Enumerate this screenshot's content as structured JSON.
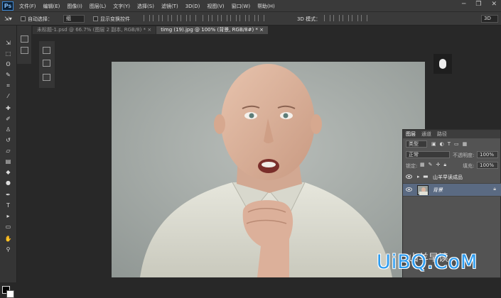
{
  "app": {
    "logo": "Ps"
  },
  "menu": [
    "文件(F)",
    "编辑(E)",
    "图像(I)",
    "图层(L)",
    "文字(Y)",
    "选择(S)",
    "滤镜(T)",
    "3D(D)",
    "视图(V)",
    "窗口(W)",
    "帮助(H)"
  ],
  "window_controls": {
    "minimize": "─",
    "restore": "❐",
    "close": "✕"
  },
  "options": {
    "auto_select_label": "自动选择：",
    "auto_select_value": "组",
    "transform_label": "显示变换控件",
    "mode_3d_label": "3D 模式：",
    "workspace": "3D"
  },
  "tabs": [
    {
      "label": "未标题-1.psd @ 66.7% (图层 2 副本, RGB/8) *",
      "active": false
    },
    {
      "label": "timg (19).jpg @ 100% (背景, RGB/8#) *",
      "active": true
    }
  ],
  "layers_panel": {
    "tabs": [
      "图层",
      "通道",
      "路径"
    ],
    "active_tab": "图层",
    "filter": "类型",
    "blend_mode": "正常",
    "opacity_label": "不透明度:",
    "opacity": "100%",
    "lock_label": "锁定:",
    "fill_label": "填充:",
    "fill": "100%",
    "layers": [
      {
        "name": "山羊早读成品",
        "type": "group"
      },
      {
        "name": "背景",
        "type": "image",
        "selected": true
      }
    ]
  },
  "watermark": {
    "text": "UiBQ.CoM",
    "overlay": "山羊早读"
  },
  "colors": {
    "selected_layer": "#5a6a82",
    "canvas_bg": "#a9b0ad",
    "ps_blue": "#3a87d6"
  }
}
